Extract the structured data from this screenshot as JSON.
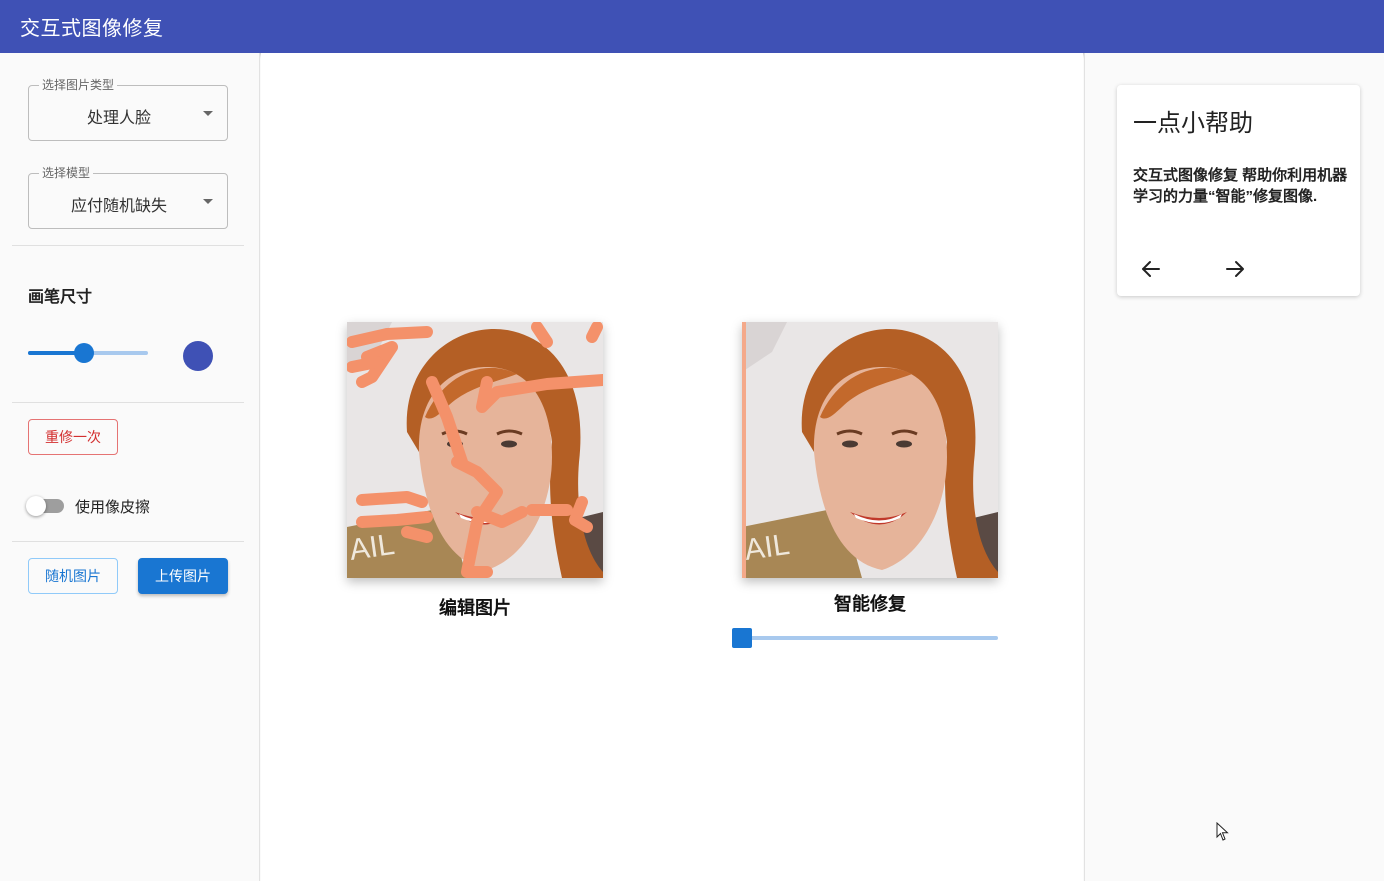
{
  "app": {
    "title": "交互式图像修复"
  },
  "sidebar": {
    "image_type": {
      "legend": "选择图片类型",
      "value": "处理人脸"
    },
    "model": {
      "legend": "选择模型",
      "value": "应付随机缺失"
    },
    "brush": {
      "title": "画笔尺寸",
      "level": 0.47
    },
    "redo_button": "重修一次",
    "eraser": {
      "label": "使用像皮擦",
      "on": false
    },
    "random_button": "随机图片",
    "upload_button": "上传图片"
  },
  "main": {
    "edit_caption": "编辑图片",
    "result_caption": "智能修复",
    "compare_slider_level": 0.0
  },
  "help_card": {
    "title": "一点小帮助",
    "body": "交互式图像修复 帮助你利用机器学习的力量“智能”修复图像.",
    "prev_icon": "arrow-left-icon",
    "next_icon": "arrow-right-icon"
  },
  "colors": {
    "appbar": "#3f51b5",
    "primary": "#1976d2",
    "mask_stroke": "#f4916a",
    "redo_outline": "#e57373"
  }
}
